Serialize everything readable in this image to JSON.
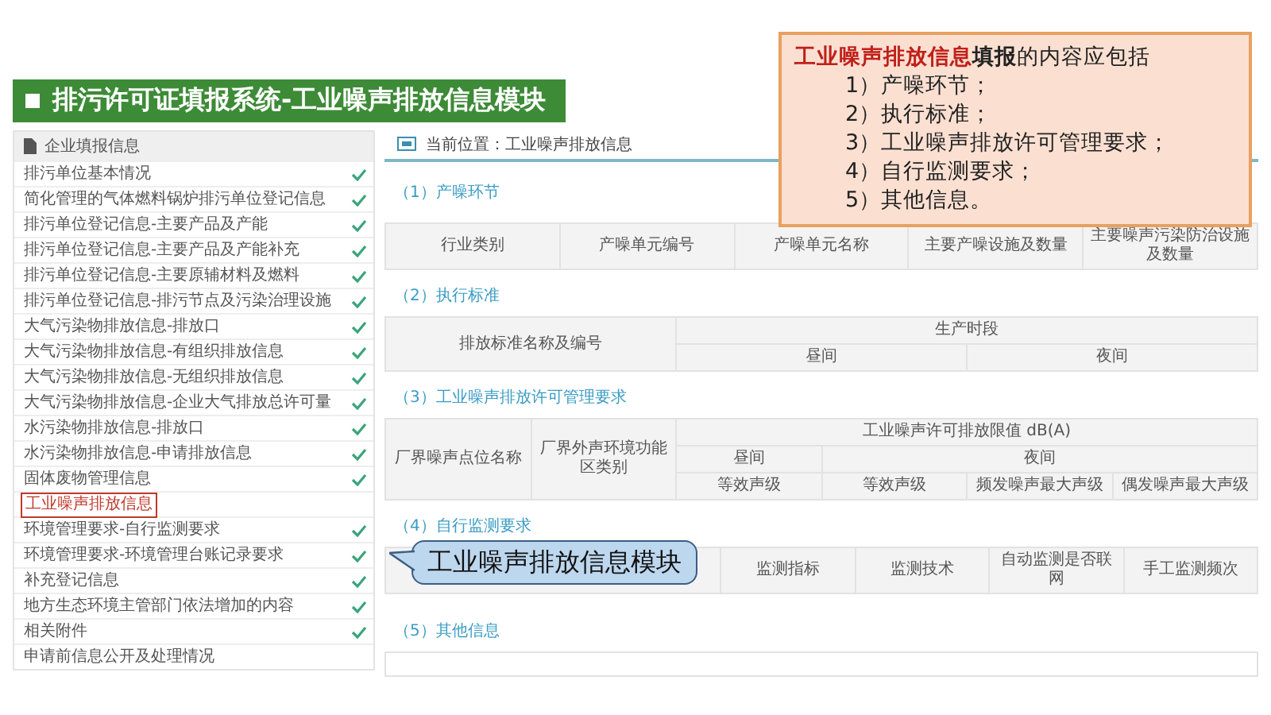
{
  "banner": {
    "title": "排污许可证填报系统-工业噪声排放信息模块"
  },
  "callout": {
    "highlight": "工业噪声排放信息",
    "rest": "**填报**的内容应包括",
    "items": [
      "1）产噪环节；",
      "2）执行标准；",
      "3）工业噪声排放许可管理要求；",
      "4）自行监测要求；",
      "5）其他信息。"
    ]
  },
  "sidebar": {
    "title": "企业填报信息",
    "items": [
      {
        "label": "排污单位基本情况",
        "done": true,
        "selected": false
      },
      {
        "label": "简化管理的气体燃料锅炉排污单位登记信息",
        "done": true,
        "selected": false
      },
      {
        "label": "排污单位登记信息-主要产品及产能",
        "done": true,
        "selected": false
      },
      {
        "label": "排污单位登记信息-主要产品及产能补充",
        "done": true,
        "selected": false
      },
      {
        "label": "排污单位登记信息-主要原辅材料及燃料",
        "done": true,
        "selected": false
      },
      {
        "label": "排污单位登记信息-排污节点及污染治理设施",
        "done": true,
        "selected": false
      },
      {
        "label": "大气污染物排放信息-排放口",
        "done": true,
        "selected": false
      },
      {
        "label": "大气污染物排放信息-有组织排放信息",
        "done": true,
        "selected": false
      },
      {
        "label": "大气污染物排放信息-无组织排放信息",
        "done": true,
        "selected": false
      },
      {
        "label": "大气污染物排放信息-企业大气排放总许可量",
        "done": true,
        "selected": false
      },
      {
        "label": "水污染物排放信息-排放口",
        "done": true,
        "selected": false
      },
      {
        "label": "水污染物排放信息-申请排放信息",
        "done": true,
        "selected": false
      },
      {
        "label": "固体废物管理信息",
        "done": true,
        "selected": false
      },
      {
        "label": "工业噪声排放信息",
        "done": false,
        "selected": true
      },
      {
        "label": "环境管理要求-自行监测要求",
        "done": true,
        "selected": false
      },
      {
        "label": "环境管理要求-环境管理台账记录要求",
        "done": true,
        "selected": false
      },
      {
        "label": "补充登记信息",
        "done": true,
        "selected": false
      },
      {
        "label": "地方生态环境主管部门依法增加的内容",
        "done": true,
        "selected": false
      },
      {
        "label": "相关附件",
        "done": true,
        "selected": false
      },
      {
        "label": "申请前信息公开及处理情况",
        "done": false,
        "selected": false
      }
    ]
  },
  "breadcrumb": "当前位置：工业噪声排放信息",
  "sections": [
    {
      "title": "（1）产噪环节",
      "kind": "table",
      "rows": [
        [
          {
            "text": "行业类别"
          },
          {
            "text": "产噪单元编号"
          },
          {
            "text": "产噪单元名称"
          },
          {
            "text": "主要产噪设施及数量"
          },
          {
            "text": "主要噪声污染防治设施及数量"
          }
        ]
      ]
    },
    {
      "title": "（2）执行标准",
      "kind": "table",
      "rows": [
        [
          {
            "text": "排放标准名称及编号",
            "rowspan": 2
          },
          {
            "text": "生产时段",
            "colspan": 2
          }
        ],
        [
          {
            "text": "昼间"
          },
          {
            "text": "夜间"
          }
        ]
      ]
    },
    {
      "title": "（3）工业噪声排放许可管理要求",
      "kind": "table",
      "rows": [
        [
          {
            "text": "厂界噪声点位名称",
            "rowspan": 3
          },
          {
            "text": "厂界外声环境功能区类别",
            "rowspan": 3
          },
          {
            "text": "工业噪声许可排放限值 dB(A)",
            "colspan": 4
          }
        ],
        [
          {
            "text": "昼间"
          },
          {
            "text": "夜间",
            "colspan": 3
          }
        ],
        [
          {
            "text": "等效声级"
          },
          {
            "text": "等效声级"
          },
          {
            "text": "频发噪声最大声级"
          },
          {
            "text": "偶发噪声最大声级"
          }
        ]
      ]
    },
    {
      "title": "（4）自行监测要求",
      "kind": "table",
      "hidden_first_column": true,
      "rows": [
        [
          {
            "text": "监测指标"
          },
          {
            "text": "监测技术"
          },
          {
            "text": "自动监测是否联网"
          },
          {
            "text": "手工监测频次"
          }
        ]
      ]
    },
    {
      "title": "（5）其他信息",
      "kind": "box"
    }
  ],
  "bubble": {
    "text": "工业噪声排放信息模块"
  }
}
